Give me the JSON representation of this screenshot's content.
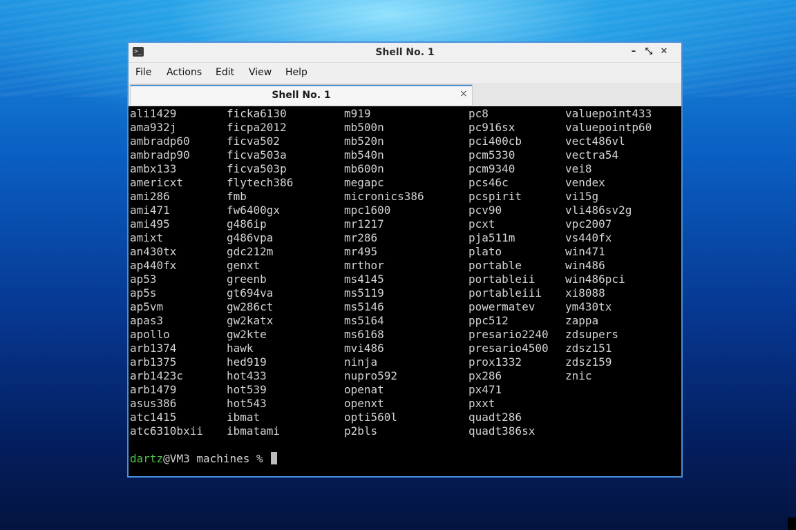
{
  "window": {
    "title": "Shell No. 1",
    "icon": "terminal-icon",
    "controls": {
      "minimize": "–",
      "maximize": "⤡",
      "close": "✕"
    }
  },
  "menu": [
    "File",
    "Actions",
    "Edit",
    "View",
    "Help"
  ],
  "tab": {
    "label": "Shell No. 1",
    "close": "×"
  },
  "terminal": {
    "columns": [
      [
        "ali1429",
        "ama932j",
        "ambradp60",
        "ambradp90",
        "ambx133",
        "americxt",
        "ami286",
        "ami471",
        "ami495",
        "amixt",
        "an430tx",
        "ap440fx",
        "ap53",
        "ap5s",
        "ap5vm",
        "apas3",
        "apollo",
        "arb1374",
        "arb1375",
        "arb1423c",
        "arb1479",
        "asus386",
        "atc1415",
        "atc6310bxii"
      ],
      [
        "ficka6130",
        "ficpa2012",
        "ficva502",
        "ficva503a",
        "ficva503p",
        "flytech386",
        "fmb",
        "fw6400gx",
        "g486ip",
        "g486vpa",
        "gdc212m",
        "genxt",
        "greenb",
        "gt694va",
        "gw286ct",
        "gw2katx",
        "gw2kte",
        "hawk",
        "hed919",
        "hot433",
        "hot539",
        "hot543",
        "ibmat",
        "ibmatami"
      ],
      [
        "m919",
        "mb500n",
        "mb520n",
        "mb540n",
        "mb600n",
        "megapc",
        "micronics386",
        "mpc1600",
        "mr1217",
        "mr286",
        "mr495",
        "mrthor",
        "ms4145",
        "ms5119",
        "ms5146",
        "ms5164",
        "ms6168",
        "mvi486",
        "ninja",
        "nupro592",
        "openat",
        "openxt",
        "opti560l",
        "p2bls"
      ],
      [
        "pc8",
        "pc916sx",
        "pci400cb",
        "pcm5330",
        "pcm9340",
        "pcs46c",
        "pcspirit",
        "pcv90",
        "pcxt",
        "pja511m",
        "plato",
        "portable",
        "portableii",
        "portableiii",
        "powermatev",
        "ppc512",
        "presario2240",
        "presario4500",
        "prox1332",
        "px286",
        "px471",
        "pxxt",
        "quadt286",
        "quadt386sx"
      ],
      [
        "valuepoint433",
        "valuepointp60",
        "vect486vl",
        "vectra54",
        "vei8",
        "vendex",
        "vi15g",
        "vli486sv2g",
        "vpc2007",
        "vs440fx",
        "win471",
        "win486",
        "win486pci",
        "xi8088",
        "ym430tx",
        "zappa",
        "zdsupers",
        "zdsz151",
        "zdsz159",
        "znic"
      ]
    ],
    "prompt": {
      "user": "dartz",
      "rest": "@VM3 machines % "
    }
  },
  "colors": {
    "accent": "#4a90d9",
    "prompt_user": "#4ec24e",
    "terminal_bg": "#000000",
    "terminal_fg": "#d3d3d3"
  }
}
